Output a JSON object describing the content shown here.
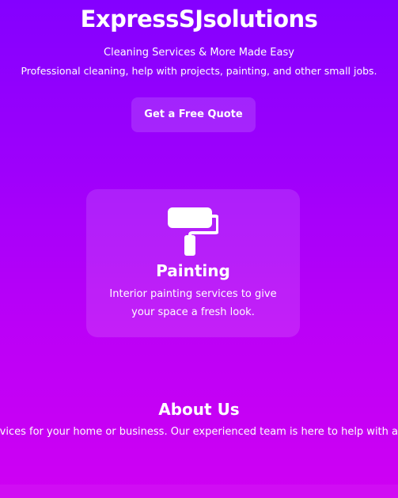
{
  "hero": {
    "title": "ExpressSJsolutions",
    "tagline": "Cleaning Services & More Made Easy",
    "description": "Professional cleaning, help with projects, painting, and other small jobs.",
    "cta_label": "Get a Free Quote"
  },
  "services": [
    {
      "icon": "paint-roller-icon",
      "title": "Painting",
      "description": "Interior painting services to give your space a fresh look."
    }
  ],
  "about": {
    "title": "About Us",
    "text": "ervices for your home or business. Our experienced team is here to help with a"
  },
  "colors": {
    "gradient_top": "#8400ff",
    "gradient_bottom": "#cf00f3",
    "text": "#ffffff"
  }
}
